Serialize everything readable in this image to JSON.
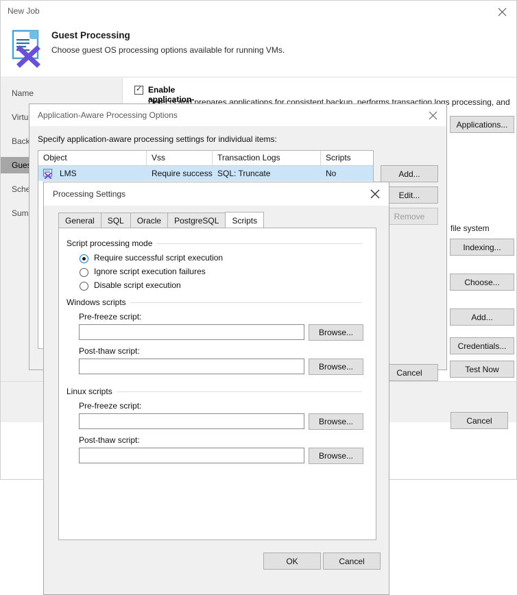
{
  "wizard": {
    "title": "New Job",
    "close_icon": "close-icon",
    "header": {
      "icon": "guest-processing-document-icon",
      "title": "Guest Processing",
      "subtitle": "Choose guest OS processing options available for running VMs."
    },
    "nav_items": [
      {
        "label": "Name",
        "selected": false
      },
      {
        "label": "Virtu",
        "selected": false
      },
      {
        "label": "Back",
        "selected": false
      },
      {
        "label": "Gues",
        "selected": true
      },
      {
        "label": "Sche",
        "selected": false
      },
      {
        "label": "Summ",
        "selected": false
      }
    ],
    "checkbox": {
      "checked": true,
      "label": "Enable application-aware processing",
      "description": "Detects and prepares applications for consistent backup, performs transaction logs processing, and"
    },
    "partial_texts": [
      {
        "text": "file system"
      }
    ],
    "side_buttons": [
      {
        "label": "Applications...",
        "disabled": false
      },
      {
        "label": "Indexing...",
        "disabled": false
      },
      {
        "label": "Choose...",
        "disabled": false
      },
      {
        "label": "Add...",
        "disabled": false
      },
      {
        "label": "Credentials...",
        "disabled": false
      },
      {
        "label": "Test Now",
        "disabled": false
      }
    ],
    "footer_buttons": [
      {
        "label": "Cancel",
        "disabled": false
      }
    ]
  },
  "aap_dialog": {
    "title": "Application-Aware Processing Options",
    "close_icon": "close-icon",
    "instruction": "Specify application-aware processing settings for individual items:",
    "table": {
      "columns": [
        "Object",
        "Vss",
        "Transaction Logs",
        "Scripts"
      ],
      "rows": [
        {
          "object": "LMS",
          "object_icon": "vm-object-icon",
          "vss": "Require success",
          "transaction_logs": "SQL: Truncate",
          "scripts": "No",
          "selected": true
        }
      ]
    },
    "buttons": [
      {
        "label": "Add...",
        "disabled": false
      },
      {
        "label": "Edit...",
        "disabled": false
      },
      {
        "label": "Remove",
        "disabled": true
      }
    ],
    "footer_buttons": [
      {
        "label": "Cancel",
        "disabled": false
      }
    ]
  },
  "processing_settings": {
    "title": "Processing Settings",
    "close_icon": "close-icon",
    "tabs": [
      {
        "label": "General",
        "active": false
      },
      {
        "label": "SQL",
        "active": false
      },
      {
        "label": "Oracle",
        "active": false
      },
      {
        "label": "PostgreSQL",
        "active": false
      },
      {
        "label": "Scripts",
        "active": true
      }
    ],
    "script_mode": {
      "group_label": "Script processing mode",
      "options": [
        {
          "label": "Require successful script execution",
          "checked": true
        },
        {
          "label": "Ignore script execution failures",
          "checked": false
        },
        {
          "label": "Disable script execution",
          "checked": false
        }
      ]
    },
    "windows_scripts": {
      "group_label": "Windows scripts",
      "pre_freeze_label": "Pre-freeze script:",
      "pre_freeze_value": "",
      "pre_freeze_browse": "Browse...",
      "post_thaw_label": "Post-thaw script:",
      "post_thaw_value": "",
      "post_thaw_browse": "Browse..."
    },
    "linux_scripts": {
      "group_label": "Linux scripts",
      "pre_freeze_label": "Pre-freeze script:",
      "pre_freeze_value": "",
      "pre_freeze_browse": "Browse...",
      "post_thaw_label": "Post-thaw script:",
      "post_thaw_value": "",
      "post_thaw_browse": "Browse..."
    },
    "footer_buttons": [
      {
        "label": "OK"
      },
      {
        "label": "Cancel"
      }
    ]
  },
  "colors": {
    "selection_blue": "#cce4f7",
    "nav_selected": "#a6a6a6",
    "dialog_bg": "#f0f0f0",
    "accent_purple": "#6b4fd8",
    "accent_blue": "#4aa3d8"
  }
}
